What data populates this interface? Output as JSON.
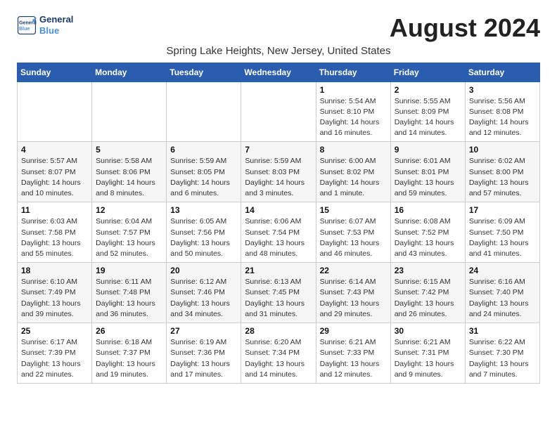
{
  "logo": {
    "line1": "General",
    "line2": "Blue"
  },
  "title": "August 2024",
  "subtitle": "Spring Lake Heights, New Jersey, United States",
  "weekdays": [
    "Sunday",
    "Monday",
    "Tuesday",
    "Wednesday",
    "Thursday",
    "Friday",
    "Saturday"
  ],
  "weeks": [
    [
      {
        "day": "",
        "info": ""
      },
      {
        "day": "",
        "info": ""
      },
      {
        "day": "",
        "info": ""
      },
      {
        "day": "",
        "info": ""
      },
      {
        "day": "1",
        "info": "Sunrise: 5:54 AM\nSunset: 8:10 PM\nDaylight: 14 hours\nand 16 minutes."
      },
      {
        "day": "2",
        "info": "Sunrise: 5:55 AM\nSunset: 8:09 PM\nDaylight: 14 hours\nand 14 minutes."
      },
      {
        "day": "3",
        "info": "Sunrise: 5:56 AM\nSunset: 8:08 PM\nDaylight: 14 hours\nand 12 minutes."
      }
    ],
    [
      {
        "day": "4",
        "info": "Sunrise: 5:57 AM\nSunset: 8:07 PM\nDaylight: 14 hours\nand 10 minutes."
      },
      {
        "day": "5",
        "info": "Sunrise: 5:58 AM\nSunset: 8:06 PM\nDaylight: 14 hours\nand 8 minutes."
      },
      {
        "day": "6",
        "info": "Sunrise: 5:59 AM\nSunset: 8:05 PM\nDaylight: 14 hours\nand 6 minutes."
      },
      {
        "day": "7",
        "info": "Sunrise: 5:59 AM\nSunset: 8:03 PM\nDaylight: 14 hours\nand 3 minutes."
      },
      {
        "day": "8",
        "info": "Sunrise: 6:00 AM\nSunset: 8:02 PM\nDaylight: 14 hours\nand 1 minute."
      },
      {
        "day": "9",
        "info": "Sunrise: 6:01 AM\nSunset: 8:01 PM\nDaylight: 13 hours\nand 59 minutes."
      },
      {
        "day": "10",
        "info": "Sunrise: 6:02 AM\nSunset: 8:00 PM\nDaylight: 13 hours\nand 57 minutes."
      }
    ],
    [
      {
        "day": "11",
        "info": "Sunrise: 6:03 AM\nSunset: 7:58 PM\nDaylight: 13 hours\nand 55 minutes."
      },
      {
        "day": "12",
        "info": "Sunrise: 6:04 AM\nSunset: 7:57 PM\nDaylight: 13 hours\nand 52 minutes."
      },
      {
        "day": "13",
        "info": "Sunrise: 6:05 AM\nSunset: 7:56 PM\nDaylight: 13 hours\nand 50 minutes."
      },
      {
        "day": "14",
        "info": "Sunrise: 6:06 AM\nSunset: 7:54 PM\nDaylight: 13 hours\nand 48 minutes."
      },
      {
        "day": "15",
        "info": "Sunrise: 6:07 AM\nSunset: 7:53 PM\nDaylight: 13 hours\nand 46 minutes."
      },
      {
        "day": "16",
        "info": "Sunrise: 6:08 AM\nSunset: 7:52 PM\nDaylight: 13 hours\nand 43 minutes."
      },
      {
        "day": "17",
        "info": "Sunrise: 6:09 AM\nSunset: 7:50 PM\nDaylight: 13 hours\nand 41 minutes."
      }
    ],
    [
      {
        "day": "18",
        "info": "Sunrise: 6:10 AM\nSunset: 7:49 PM\nDaylight: 13 hours\nand 39 minutes."
      },
      {
        "day": "19",
        "info": "Sunrise: 6:11 AM\nSunset: 7:48 PM\nDaylight: 13 hours\nand 36 minutes."
      },
      {
        "day": "20",
        "info": "Sunrise: 6:12 AM\nSunset: 7:46 PM\nDaylight: 13 hours\nand 34 minutes."
      },
      {
        "day": "21",
        "info": "Sunrise: 6:13 AM\nSunset: 7:45 PM\nDaylight: 13 hours\nand 31 minutes."
      },
      {
        "day": "22",
        "info": "Sunrise: 6:14 AM\nSunset: 7:43 PM\nDaylight: 13 hours\nand 29 minutes."
      },
      {
        "day": "23",
        "info": "Sunrise: 6:15 AM\nSunset: 7:42 PM\nDaylight: 13 hours\nand 26 minutes."
      },
      {
        "day": "24",
        "info": "Sunrise: 6:16 AM\nSunset: 7:40 PM\nDaylight: 13 hours\nand 24 minutes."
      }
    ],
    [
      {
        "day": "25",
        "info": "Sunrise: 6:17 AM\nSunset: 7:39 PM\nDaylight: 13 hours\nand 22 minutes."
      },
      {
        "day": "26",
        "info": "Sunrise: 6:18 AM\nSunset: 7:37 PM\nDaylight: 13 hours\nand 19 minutes."
      },
      {
        "day": "27",
        "info": "Sunrise: 6:19 AM\nSunset: 7:36 PM\nDaylight: 13 hours\nand 17 minutes."
      },
      {
        "day": "28",
        "info": "Sunrise: 6:20 AM\nSunset: 7:34 PM\nDaylight: 13 hours\nand 14 minutes."
      },
      {
        "day": "29",
        "info": "Sunrise: 6:21 AM\nSunset: 7:33 PM\nDaylight: 13 hours\nand 12 minutes."
      },
      {
        "day": "30",
        "info": "Sunrise: 6:21 AM\nSunset: 7:31 PM\nDaylight: 13 hours\nand 9 minutes."
      },
      {
        "day": "31",
        "info": "Sunrise: 6:22 AM\nSunset: 7:30 PM\nDaylight: 13 hours\nand 7 minutes."
      }
    ]
  ],
  "colors": {
    "header_bg": "#2a5db0",
    "row_alt": "#f0f0f0"
  }
}
